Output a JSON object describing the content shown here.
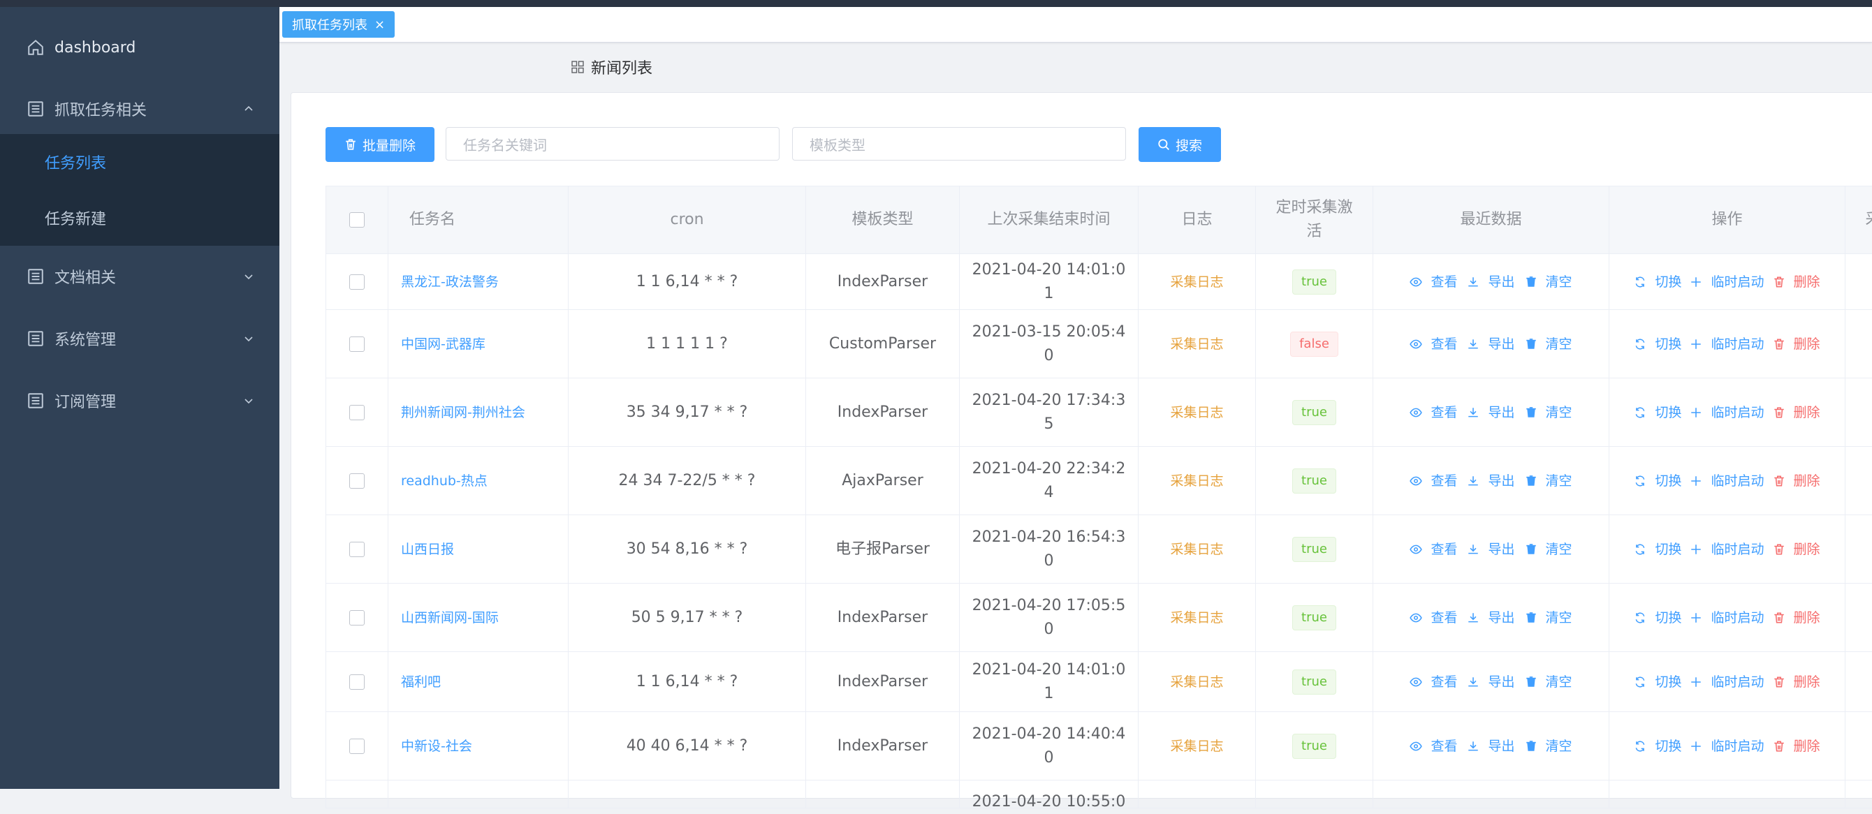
{
  "sidebar": {
    "items": [
      {
        "label": "dashboard",
        "icon": "home-icon"
      },
      {
        "label": "抓取任务相关",
        "icon": "list-icon",
        "expanded": true,
        "children": [
          {
            "label": "任务列表",
            "active": true
          },
          {
            "label": "任务新建"
          }
        ]
      },
      {
        "label": "文档相关",
        "icon": "list-icon"
      },
      {
        "label": "系统管理",
        "icon": "list-icon"
      },
      {
        "label": "订阅管理",
        "icon": "list-icon"
      }
    ]
  },
  "tabs": [
    {
      "label": "抓取任务列表",
      "close": "×"
    }
  ],
  "card": {
    "title": "新闻列表"
  },
  "toolbar": {
    "batch_delete": "批量删除",
    "name_placeholder": "任务名关键词",
    "type_placeholder": "模板类型",
    "search": "搜索"
  },
  "table": {
    "headers": [
      "",
      "任务名",
      "cron",
      "模板类型",
      "上次采集结束时间",
      "日志",
      "定时采集激活",
      "最近数据",
      "操作",
      "采"
    ],
    "log_label": "采集日志",
    "recent_actions": [
      "查看",
      "导出",
      "清空"
    ],
    "ops_actions": [
      "切换",
      "临时启动",
      "删除"
    ],
    "rows": [
      {
        "name": "黑龙江-政法警务",
        "cron": "1 1 6,14 * * ?",
        "type": "IndexParser",
        "time": "2021-04-20 14:01:01",
        "active": "true"
      },
      {
        "name": "中国网-武器库",
        "cron": "1 1 1 1 1 ?",
        "type": "CustomParser",
        "time": "2021-03-15 20:05:40",
        "active": "false"
      },
      {
        "name": "荆州新闻网-荆州社会",
        "cron": "35 34 9,17 * * ?",
        "type": "IndexParser",
        "time": "2021-04-20 17:34:35",
        "active": "true"
      },
      {
        "name": "readhub-热点",
        "cron": "24 34 7-22/5 * * ?",
        "type": "AjaxParser",
        "time": "2021-04-20 22:34:24",
        "active": "true"
      },
      {
        "name": "山西日报",
        "cron": "30 54 8,16 * * ?",
        "type": "电子报Parser",
        "time": "2021-04-20 16:54:30",
        "active": "true"
      },
      {
        "name": "山西新闻网-国际",
        "cron": "50 5 9,17 * * ?",
        "type": "IndexParser",
        "time": "2021-04-20 17:05:50",
        "active": "true"
      },
      {
        "name": "福利吧",
        "cron": "1 1 6,14 * * ?",
        "type": "IndexParser",
        "time": "2021-04-20 14:01:01",
        "active": "true"
      },
      {
        "name": "中新设-社会",
        "cron": "40 40 6,14 * * ?",
        "type": "IndexParser",
        "time": "2021-04-20 14:40:40",
        "active": "true"
      },
      {
        "name": "",
        "cron": "",
        "type": "",
        "time": "2021-04-20 10:55:0",
        "active": ""
      }
    ]
  },
  "colors": {
    "primary": "#409eff",
    "sidebar": "#304156",
    "warning": "#e6a23c",
    "success": "#67c23a",
    "danger": "#f56c6c"
  }
}
